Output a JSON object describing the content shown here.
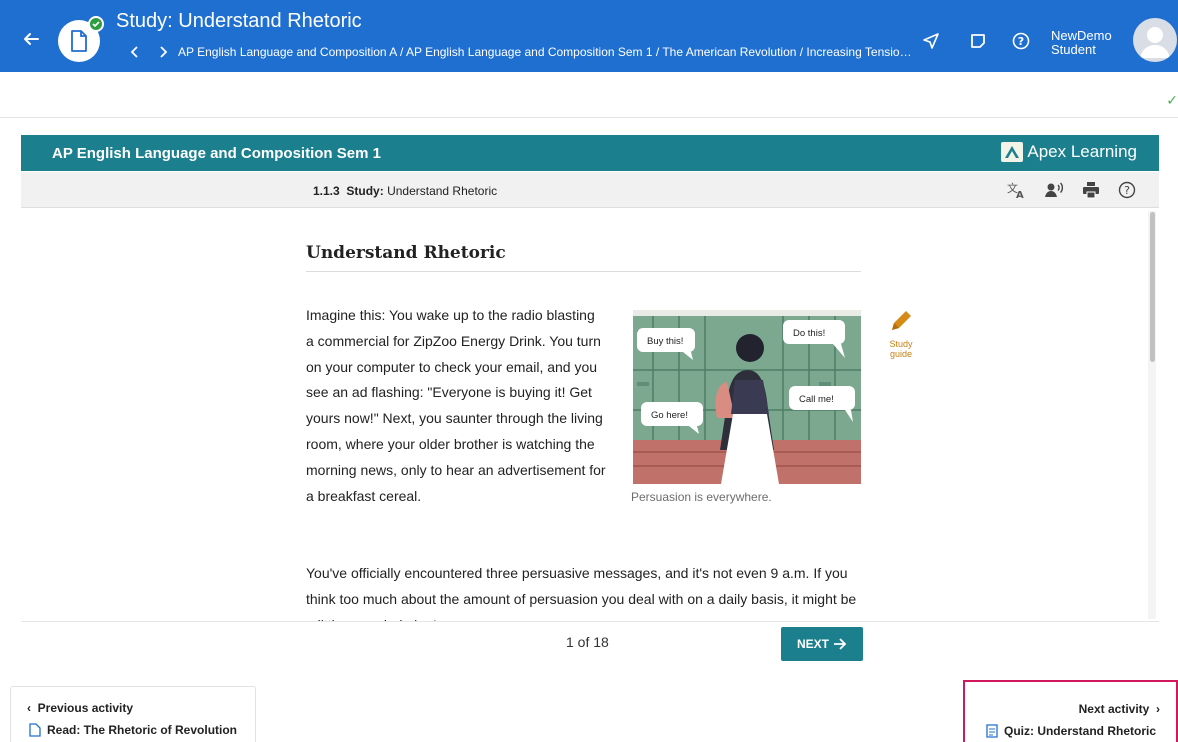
{
  "topbar": {
    "title": "Study: Understand Rhetoric",
    "breadcrumb": "AP English Language and Composition A / AP English Language and Composition Sem 1 / The American Revolution / Increasing Tensions",
    "user_name_line1": "NewDemo",
    "user_name_line2": "Student",
    "colors": {
      "bar": "#1f6fd1",
      "status": "#2e9c3f"
    },
    "icons": [
      "back-arrow-icon",
      "document-icon",
      "check-icon",
      "chevron-left-icon",
      "chevron-right-icon",
      "send-icon",
      "note-icon",
      "help-icon",
      "avatar-icon"
    ]
  },
  "course": {
    "title": "AP English Language and Composition Sem 1",
    "brand": "Apex Learning",
    "color": "#1b7f8e"
  },
  "activity": {
    "number": "1.1.3",
    "kind": "Study:",
    "name": "Understand Rhetoric",
    "tools": [
      "translate-icon",
      "read-aloud-icon",
      "print-icon",
      "help-icon"
    ]
  },
  "lesson": {
    "heading": "Understand Rhetoric",
    "paragraph1": "Imagine this: You wake up to the radio blasting a commercial for ZipZoo Energy Drink. You turn on your computer to check your email, and you see an ad flashing: \"Everyone is buying it! Get yours now!\" Next, you saunter through the living room, where your older brother is watching the morning news, only to hear an advertisement for a breakfast cereal.",
    "paragraph2": "You've officially encountered three persuasive messages, and it's not even 9 a.m. If you think too much about the amount of persuasion you deal with on a daily basis, it might be a little overwhelming!",
    "image_bubbles": [
      "Buy this!",
      "Do this!",
      "Call me!",
      "Go here!"
    ],
    "caption": "Persuasion is everywhere.",
    "study_guide_line1": "Study",
    "study_guide_line2": "guide",
    "study_guide_color": "#c88114"
  },
  "pager": {
    "count": "1 of 18",
    "next_label": "NEXT"
  },
  "nav": {
    "previous_label": "Previous activity",
    "previous_item": "Read: The Rhetoric of Revolution",
    "next_label": "Next activity",
    "next_item": "Quiz: Understand Rhetoric",
    "highlight_color": "#d2185c"
  }
}
